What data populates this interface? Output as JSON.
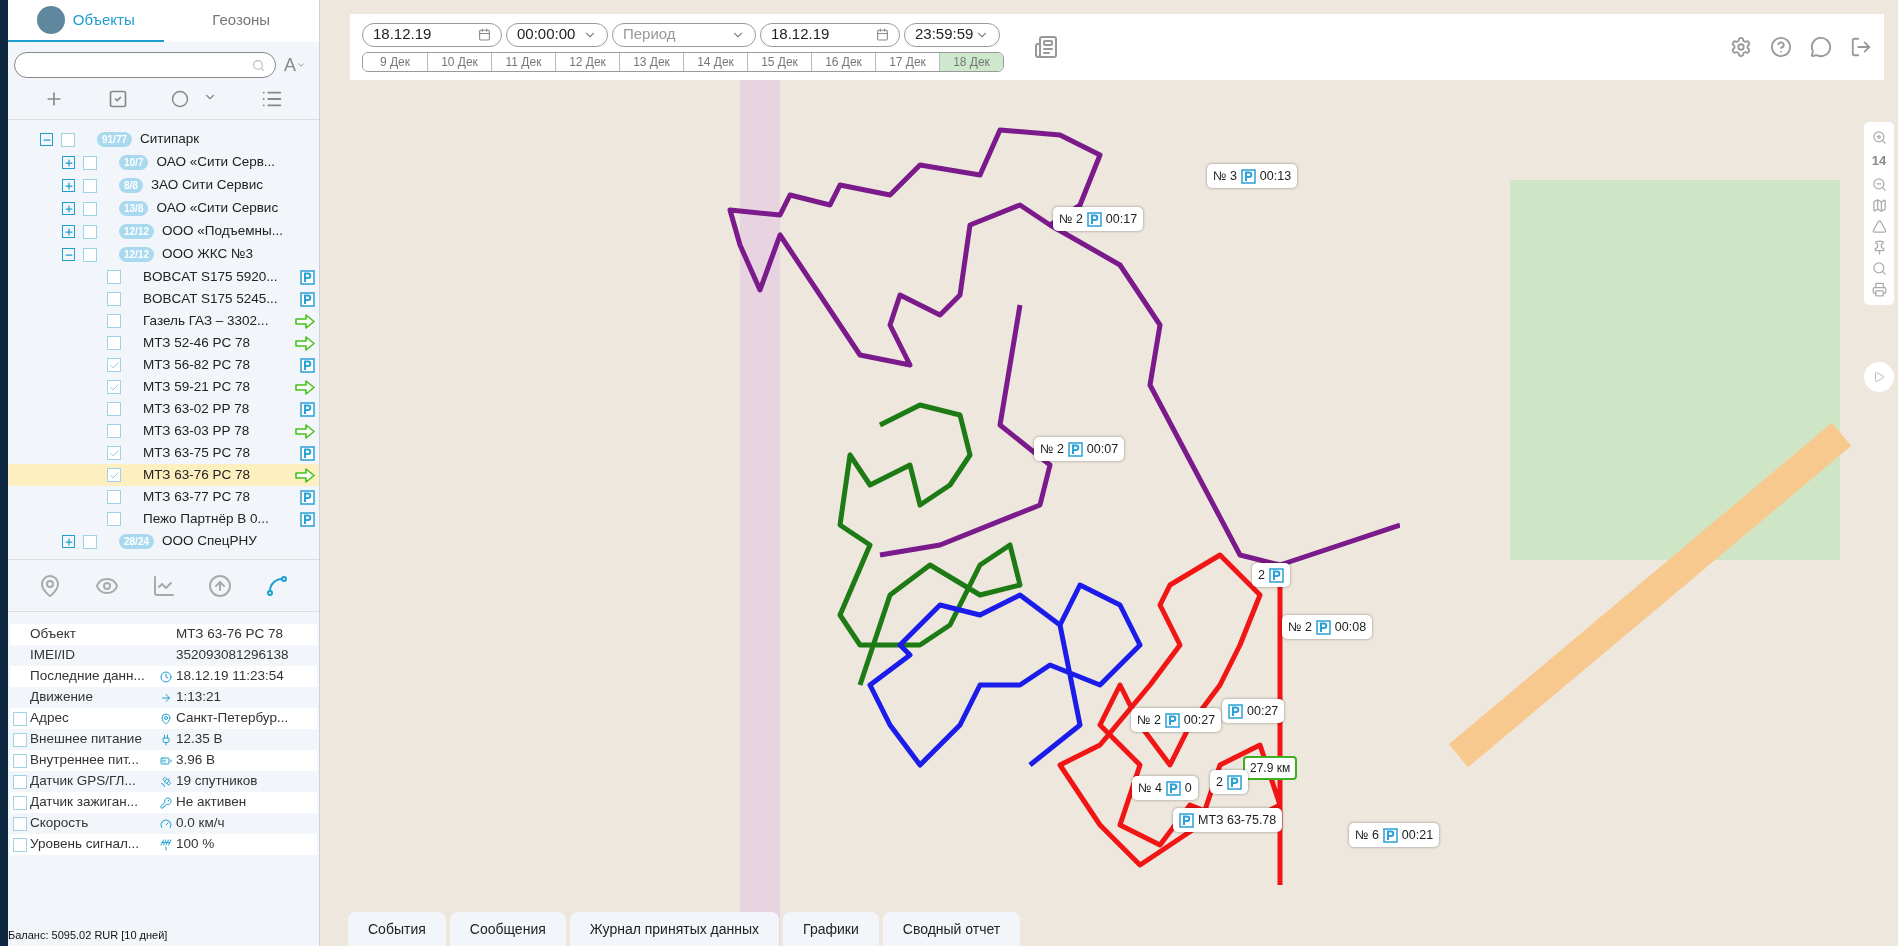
{
  "tabs": [
    {
      "label": "Объекты",
      "selected": true
    },
    {
      "label": "Геозоны",
      "selected": false
    }
  ],
  "search": {
    "sort_label": "A"
  },
  "tree": [
    {
      "count": "91/77",
      "name": "Ситипарк",
      "expanded": true,
      "checked": false,
      "children": [
        {
          "count": "10/7",
          "name": "ОАО «Сити Серв...",
          "expanded": false,
          "checked": false
        },
        {
          "count": "8/8",
          "name": "ЗАО Сити Сервис",
          "expanded": false,
          "checked": false
        },
        {
          "count": "13/8",
          "name": "ОАО «Сити Сервис",
          "expanded": false,
          "checked": false
        },
        {
          "count": "12/12",
          "name": "ООО «Подъемны...",
          "expanded": false,
          "checked": false
        },
        {
          "count": "12/12",
          "name": "ООО ЖКС №3",
          "expanded": true,
          "checked": false,
          "units": [
            {
              "name": "BOBCAT S175 5920...",
              "checked": false,
              "selected": false,
              "kind": "parking"
            },
            {
              "name": "BOBCAT S175 5245...",
              "checked": false,
              "selected": false,
              "kind": "parking"
            },
            {
              "name": "Газель ГАЗ – 3302...",
              "checked": false,
              "selected": false,
              "kind": "moving"
            },
            {
              "name": "МТЗ 52-46 РС 78",
              "checked": false,
              "selected": false,
              "kind": "moving"
            },
            {
              "name": "МТЗ 56-82 РС 78",
              "checked": true,
              "selected": false,
              "kind": "parking"
            },
            {
              "name": "МТЗ 59-21 РС 78",
              "checked": true,
              "selected": false,
              "kind": "moving"
            },
            {
              "name": "МТЗ 63-02 РР 78",
              "checked": false,
              "selected": false,
              "kind": "parking"
            },
            {
              "name": "МТЗ 63-03 РР 78",
              "checked": false,
              "selected": false,
              "kind": "moving"
            },
            {
              "name": "МТЗ 63-75 РС 78",
              "checked": true,
              "selected": false,
              "kind": "parking"
            },
            {
              "name": "МТЗ 63-76 РС 78",
              "checked": true,
              "selected": true,
              "kind": "moving"
            },
            {
              "name": "МТЗ 63-77 РС 78",
              "checked": false,
              "selected": false,
              "kind": "parking"
            },
            {
              "name": "Пежо Партнёр В 0...",
              "checked": false,
              "selected": false,
              "kind": "parking"
            }
          ]
        },
        {
          "count": "28/24",
          "name": "ООО СпецРНУ",
          "expanded": false,
          "checked": false
        }
      ]
    }
  ],
  "tools": [
    {
      "selected": false
    },
    {
      "selected": false
    },
    {
      "selected": false
    },
    {
      "selected": false
    },
    {
      "selected": true
    }
  ],
  "info": [
    {
      "label": "Объект",
      "value": "МТЗ 63-76 РС 78",
      "kind": "plain"
    },
    {
      "label": "IMEI/ID",
      "value": "352093081296138",
      "kind": "plain"
    },
    {
      "label": "Последние данн...",
      "value": "18.12.19 11:23:54",
      "kind": "plain"
    },
    {
      "label": "Движение",
      "value": "1:13:21",
      "kind": "plain"
    },
    {
      "label": "Адрес",
      "value": "Санкт-Петербур...",
      "kind": "checkable",
      "checked": false
    },
    {
      "label": "Внешнее питание",
      "value": "12.35 В",
      "kind": "checkable",
      "checked": false
    },
    {
      "label": "Внутреннее пит...",
      "value": "3.96 В",
      "kind": "checkable",
      "checked": false
    },
    {
      "label": "Датчик GPS/ГЛ...",
      "value": "19 спутников",
      "kind": "checkable",
      "checked": false
    },
    {
      "label": "Датчик зажиган...",
      "value": "Не активен",
      "kind": "checkable",
      "checked": false
    },
    {
      "label": "Скорость",
      "value": "0.0 км/ч",
      "kind": "checkable",
      "checked": false
    },
    {
      "label": "Уровень сигнал...",
      "value": "100 %",
      "kind": "checkable",
      "checked": false
    }
  ],
  "balance": "Баланс: 5095.02 RUR [10 дней]",
  "period": {
    "date_from": "18.12.19",
    "time_from": "00:00:00",
    "period_placeholder": "Период",
    "date_to": "18.12.19",
    "time_to": "23:59:59"
  },
  "days": [
    {
      "label": "9 Дек",
      "selected": false
    },
    {
      "label": "10 Дек",
      "selected": false
    },
    {
      "label": "11 Дек",
      "selected": false
    },
    {
      "label": "12 Дек",
      "selected": false
    },
    {
      "label": "13 Дек",
      "selected": false
    },
    {
      "label": "14 Дек",
      "selected": false
    },
    {
      "label": "15 Дек",
      "selected": false
    },
    {
      "label": "16 Дек",
      "selected": false
    },
    {
      "label": "17 Дек",
      "selected": false
    },
    {
      "label": "18 Дек",
      "selected": true
    }
  ],
  "zoom_level": "14",
  "markers": [
    {
      "kind": "stop",
      "before": "№ 3",
      "after": "00:13"
    },
    {
      "kind": "stop",
      "before": "№ 2",
      "after": "00:17"
    },
    {
      "kind": "stop",
      "before": "№ 2",
      "after": "00:07"
    },
    {
      "kind": "stop",
      "before": "2"
    },
    {
      "kind": "stop",
      "before": "№ 2",
      "after": "00:08"
    },
    {
      "kind": "stop",
      "after": "00:27"
    },
    {
      "kind": "stop",
      "before": "№ 2",
      "after": "00:27"
    },
    {
      "kind": "distance",
      "before": "27.9 км"
    },
    {
      "kind": "stop",
      "before": "№ 4",
      "after": "0"
    },
    {
      "kind": "stop",
      "before": "2"
    },
    {
      "kind": "stop",
      "after": "МТЗ 63-75.78"
    },
    {
      "kind": "stop",
      "before": "№ 6",
      "after": "00:21"
    }
  ],
  "bottom_tabs": [
    "События",
    "Сообщения",
    "Журнал принятых данных",
    "Графики",
    "Сводный отчет"
  ]
}
